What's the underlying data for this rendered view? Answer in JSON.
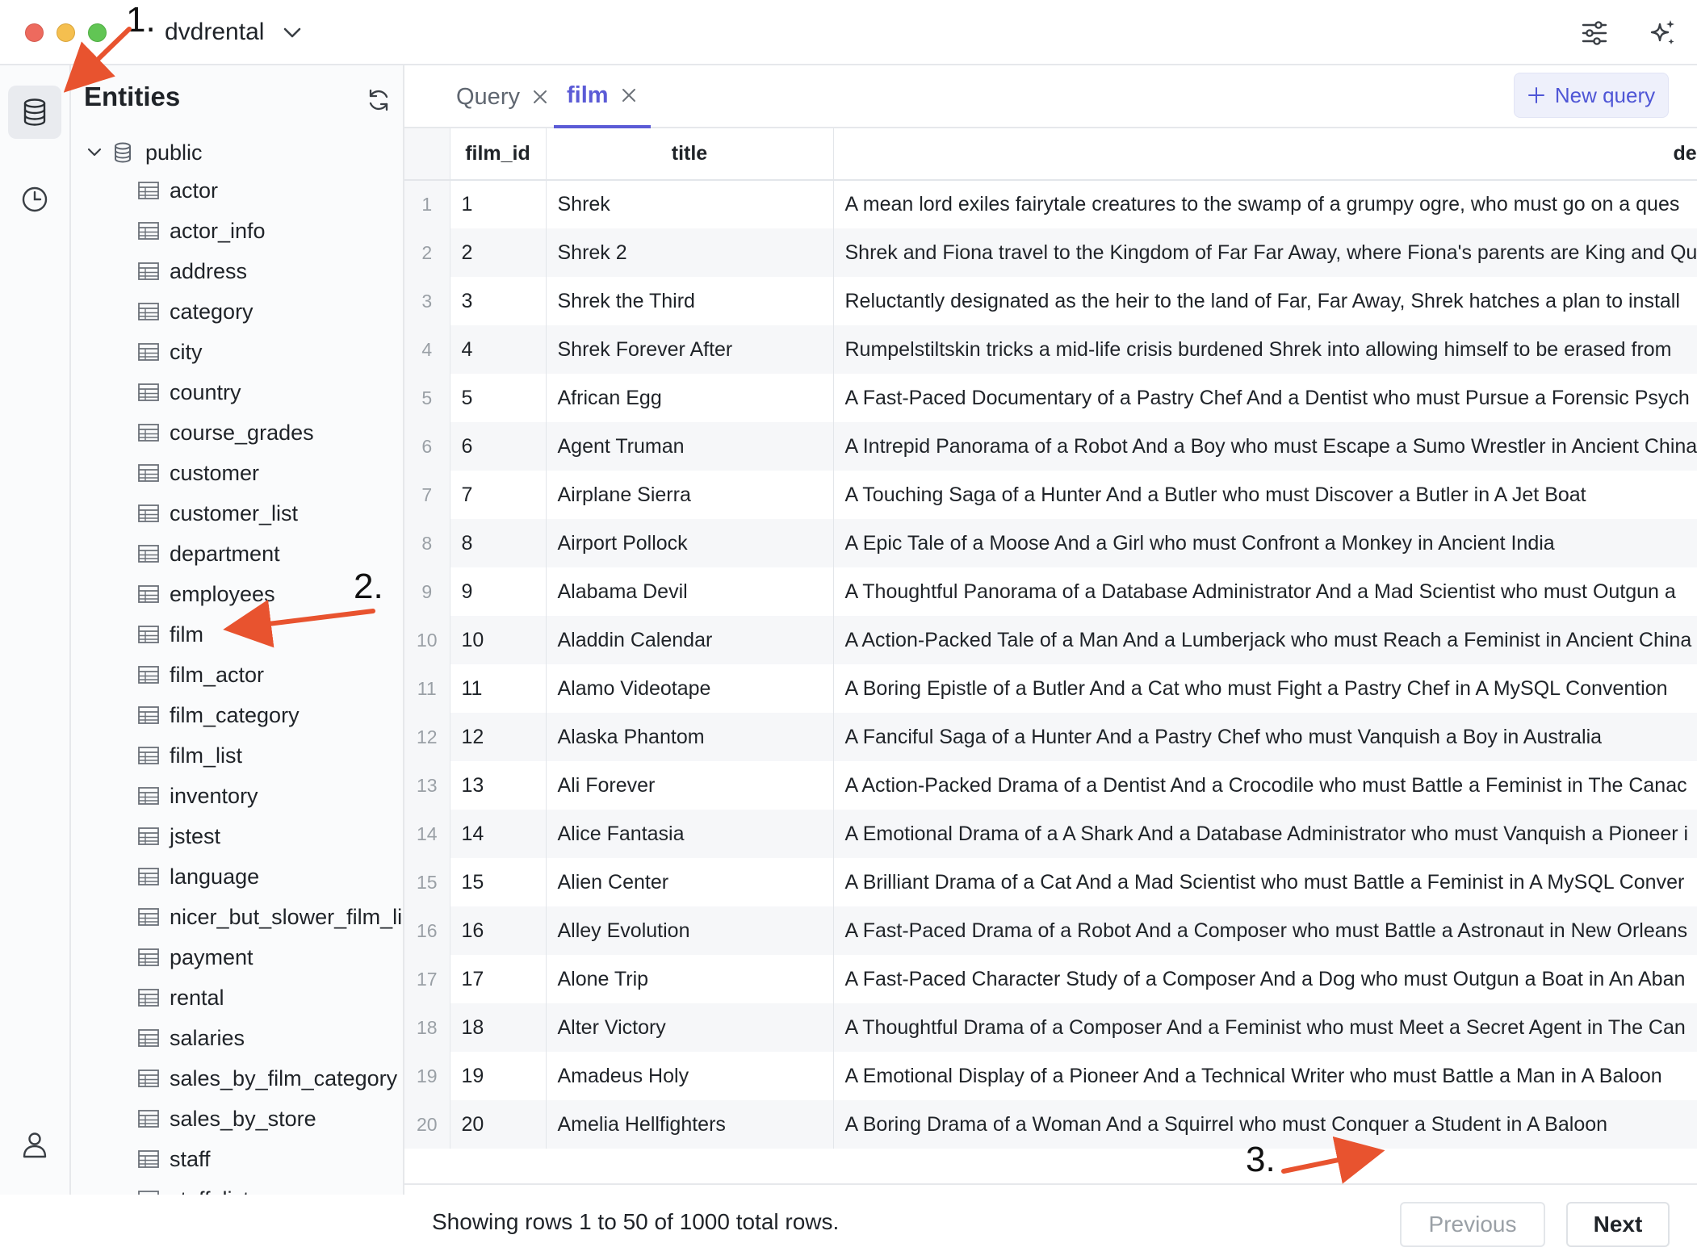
{
  "window": {
    "database_name": "dvdrental"
  },
  "entities_panel": {
    "title": "Entities",
    "schema": "public",
    "tables": [
      "actor",
      "actor_info",
      "address",
      "category",
      "city",
      "country",
      "course_grades",
      "customer",
      "customer_list",
      "department",
      "employees",
      "film",
      "film_actor",
      "film_category",
      "film_list",
      "inventory",
      "jstest",
      "language",
      "nicer_but_slower_film_li",
      "payment",
      "rental",
      "salaries",
      "sales_by_film_category",
      "sales_by_store",
      "staff",
      "staff_list"
    ]
  },
  "tabs": [
    {
      "label": "Query",
      "active": false
    },
    {
      "label": "film",
      "active": true
    }
  ],
  "new_query_label": "New query",
  "grid": {
    "columns": [
      "film_id",
      "title",
      "description"
    ],
    "rows": [
      {
        "n": "1",
        "id": "1",
        "title": "Shrek",
        "description": "A mean lord exiles fairytale creatures to the swamp of a grumpy ogre, who must go on a ques"
      },
      {
        "n": "2",
        "id": "2",
        "title": "Shrek 2",
        "description": "Shrek and Fiona travel to the Kingdom of Far Far Away, where Fiona's parents are King and Qu"
      },
      {
        "n": "3",
        "id": "3",
        "title": "Shrek the Third",
        "description": "Reluctantly designated as the heir to the land of Far, Far Away, Shrek hatches a plan to install"
      },
      {
        "n": "4",
        "id": "4",
        "title": "Shrek Forever After",
        "description": "Rumpelstiltskin tricks a mid-life crisis burdened Shrek into allowing himself to be erased from"
      },
      {
        "n": "5",
        "id": "5",
        "title": "African Egg",
        "description": "A Fast-Paced Documentary of a Pastry Chef And a Dentist who must Pursue a Forensic Psych"
      },
      {
        "n": "6",
        "id": "6",
        "title": "Agent Truman",
        "description": "A Intrepid Panorama of a Robot And a Boy who must Escape a Sumo Wrestler in Ancient China"
      },
      {
        "n": "7",
        "id": "7",
        "title": "Airplane Sierra",
        "description": "A Touching Saga of a Hunter And a Butler who must Discover a Butler in A Jet Boat"
      },
      {
        "n": "8",
        "id": "8",
        "title": "Airport Pollock",
        "description": "A Epic Tale of a Moose And a Girl who must Confront a Monkey in Ancient India"
      },
      {
        "n": "9",
        "id": "9",
        "title": "Alabama Devil",
        "description": "A Thoughtful Panorama of a Database Administrator And a Mad Scientist who must Outgun a"
      },
      {
        "n": "10",
        "id": "10",
        "title": "Aladdin Calendar",
        "description": "A Action-Packed Tale of a Man And a Lumberjack who must Reach a Feminist in Ancient China"
      },
      {
        "n": "11",
        "id": "11",
        "title": "Alamo Videotape",
        "description": "A Boring Epistle of a Butler And a Cat who must Fight a Pastry Chef in A MySQL Convention"
      },
      {
        "n": "12",
        "id": "12",
        "title": "Alaska Phantom",
        "description": "A Fanciful Saga of a Hunter And a Pastry Chef who must Vanquish a Boy in Australia"
      },
      {
        "n": "13",
        "id": "13",
        "title": "Ali Forever",
        "description": "A Action-Packed Drama of a Dentist And a Crocodile who must Battle a Feminist in The Canac"
      },
      {
        "n": "14",
        "id": "14",
        "title": "Alice Fantasia",
        "description": "A Emotional Drama of a A Shark And a Database Administrator who must Vanquish a Pioneer i"
      },
      {
        "n": "15",
        "id": "15",
        "title": "Alien Center",
        "description": "A Brilliant Drama of a Cat And a Mad Scientist who must Battle a Feminist in A MySQL Conver"
      },
      {
        "n": "16",
        "id": "16",
        "title": "Alley Evolution",
        "description": "A Fast-Paced Drama of a Robot And a Composer who must Battle a Astronaut in New Orleans"
      },
      {
        "n": "17",
        "id": "17",
        "title": "Alone Trip",
        "description": "A Fast-Paced Character Study of a Composer And a Dog who must Outgun a Boat in An Aban"
      },
      {
        "n": "18",
        "id": "18",
        "title": "Alter Victory",
        "description": "A Thoughtful Drama of a Composer And a Feminist who must Meet a Secret Agent in The Can"
      },
      {
        "n": "19",
        "id": "19",
        "title": "Amadeus Holy",
        "description": "A Emotional Display of a Pioneer And a Technical Writer who must Battle a Man in A Baloon"
      },
      {
        "n": "20",
        "id": "20",
        "title": "Amelia Hellfighters",
        "description": "A Boring Drama of a Woman And a Squirrel who must Conquer a Student in A Baloon"
      }
    ]
  },
  "footer": {
    "status": "Showing rows 1 to 50 of 1000 total rows.",
    "previous_label": "Previous",
    "next_label": "Next",
    "previous_disabled": true
  },
  "annotations": {
    "step1": "1.",
    "step2": "2.",
    "step3": "3.",
    "arrow_color": "#e8532f"
  },
  "colors": {
    "accent": "#5b5bd6",
    "close_light": "#ed6a5e",
    "minimize_light": "#f5bf4f",
    "zoom_light": "#61c554"
  }
}
